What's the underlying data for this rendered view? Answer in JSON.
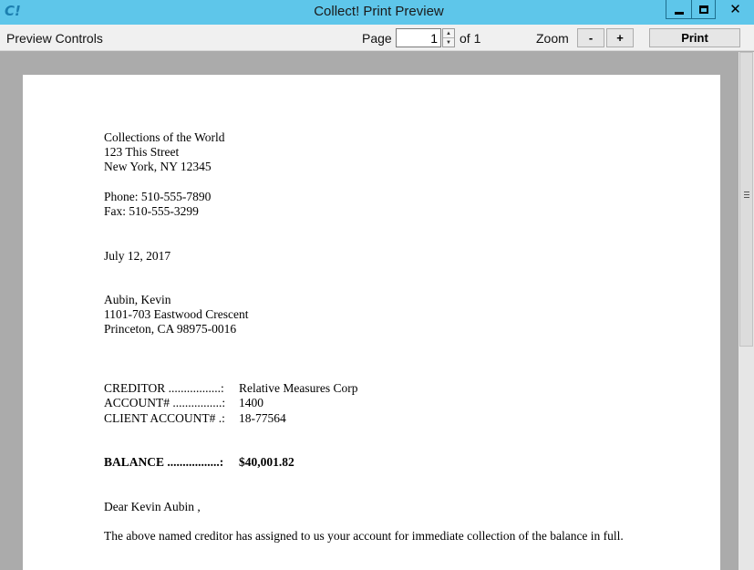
{
  "window": {
    "logo_text": "C!",
    "title": "Collect! Print Preview",
    "close_glyph": "✕"
  },
  "toolbar": {
    "preview_controls_label": "Preview Controls",
    "page_label": "Page",
    "page_value": "1",
    "of_label": "of 1",
    "zoom_label": "Zoom",
    "zoom_out_label": "-",
    "zoom_in_label": "+",
    "print_label": "Print"
  },
  "letter": {
    "sender": {
      "name": "Collections of the World",
      "street": "123 This Street",
      "city": "New York, NY 12345",
      "phone": "Phone: 510-555-7890",
      "fax": "Fax: 510-555-3299"
    },
    "date": "July 12, 2017",
    "recipient": {
      "name": "Aubin, Kevin",
      "street": "1101-703 Eastwood Crescent",
      "city": "Princeton, CA 98975-0016"
    },
    "details": {
      "creditor_label": "CREDITOR .................:",
      "creditor_value": "Relative Measures Corp",
      "account_label": "ACCOUNT# ................:",
      "account_value": "1400",
      "client_account_label": "CLIENT ACCOUNT# .:",
      "client_account_value": "18-77564"
    },
    "balance_label": "BALANCE .................:",
    "balance_value": "$40,001.82",
    "salutation": "Dear Kevin Aubin ,",
    "body": "The above named creditor has assigned to us your account for immediate collection of the balance in full."
  }
}
